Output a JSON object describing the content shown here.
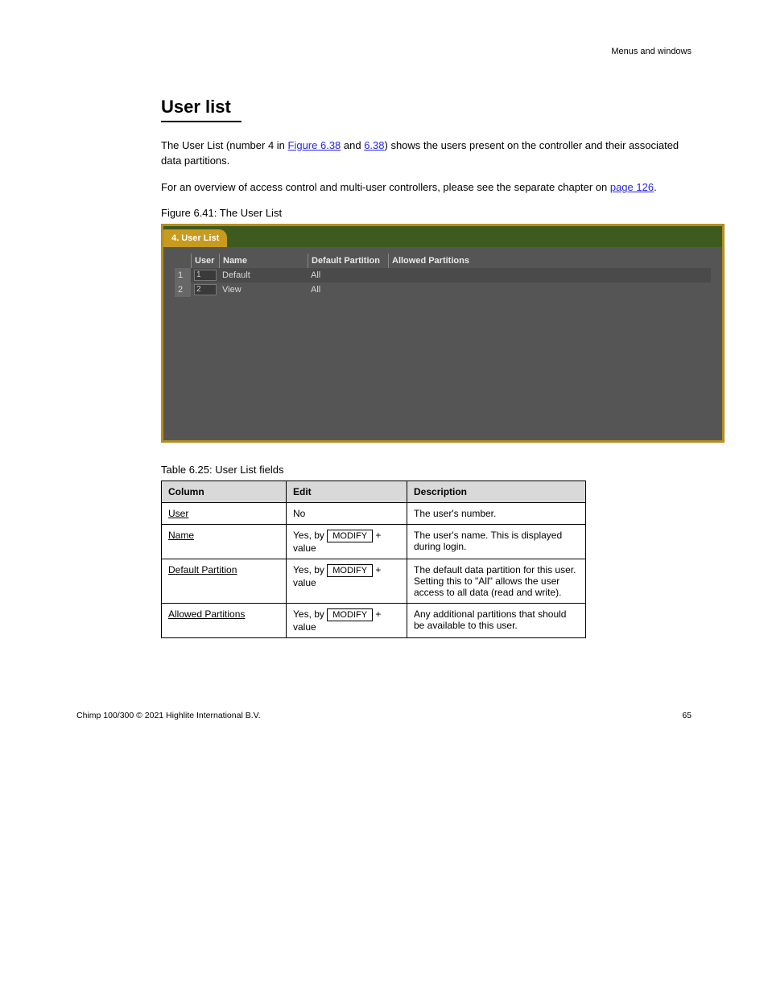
{
  "header": {
    "right": "Menus and windows"
  },
  "section": {
    "title": "User list",
    "para1_pre": "The User List (number ",
    "para1_num": "4",
    "para1_mid": " in ",
    "para1_link1": "Figure 6.38",
    "para1_after1": " and ",
    "para1_link2": "6.38",
    "para1_suffix": ") shows the users present on the controller and their associated data partitions.",
    "para2_pre": "For an overview of access control and multi-user controllers, please see the separate chapter on ",
    "para2_link": "page 126",
    "para2_suffix": "."
  },
  "figure_caption": "Figure 6.41: The User List",
  "ui": {
    "tab": "4. User List",
    "headers": {
      "user": "User",
      "name": "Name",
      "def": "Default Partition",
      "allow": "Allowed Partitions"
    },
    "rows": [
      {
        "idx": "1",
        "user": "1",
        "name": "Default",
        "def": "All",
        "allow": ""
      },
      {
        "idx": "2",
        "user": "2",
        "name": "View",
        "def": "All",
        "allow": ""
      }
    ]
  },
  "spec_caption": "Table 6.25: User List fields",
  "spec": {
    "headers": {
      "col": "Column",
      "edit": "Edit",
      "desc": "Description"
    },
    "rows": [
      {
        "col": "User",
        "edit": "No",
        "desc": "The user's number."
      },
      {
        "col": "Name",
        "edit_prefix": "Yes, by ",
        "edit_suffix": " + value",
        "desc": "The user's name. This is displayed during login."
      },
      {
        "col": "Default Partition",
        "edit_prefix": "Yes, by ",
        "edit_suffix": " + value",
        "desc": "The default data partition for this user. Setting this to \"All\" allows the user access to all data (read and write)."
      },
      {
        "col": "Allowed Partitions",
        "edit_prefix": "Yes, by ",
        "edit_suffix": " + value",
        "desc": "Any additional partitions that should be available to this user."
      }
    ],
    "modify_label": "MODIFY"
  },
  "footer": {
    "left": "Chimp 100/300 © 2021 Highlite International B.V.",
    "right": "65"
  }
}
